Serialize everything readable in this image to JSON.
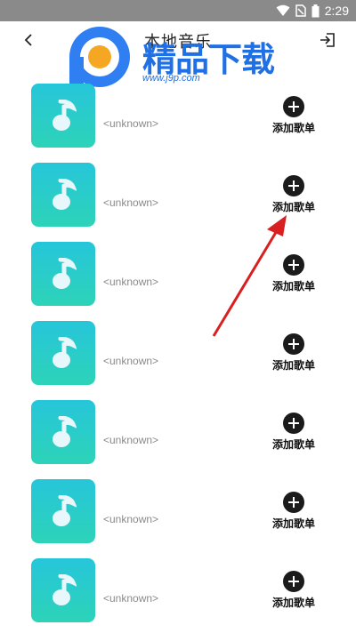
{
  "status_bar": {
    "time": "2:29"
  },
  "header": {
    "title": "本地音乐"
  },
  "watermark": {
    "brand": "精品下载",
    "url": "www.j9p.com"
  },
  "songs": [
    {
      "title": "<unknown>",
      "add_label": "添加歌单"
    },
    {
      "title": "<unknown>",
      "add_label": "添加歌单"
    },
    {
      "title": "<unknown>",
      "add_label": "添加歌单"
    },
    {
      "title": "<unknown>",
      "add_label": "添加歌单"
    },
    {
      "title": "<unknown>",
      "add_label": "添加歌单"
    },
    {
      "title": "<unknown>",
      "add_label": "添加歌单"
    },
    {
      "title": "<unknown>",
      "add_label": "添加歌单"
    }
  ]
}
